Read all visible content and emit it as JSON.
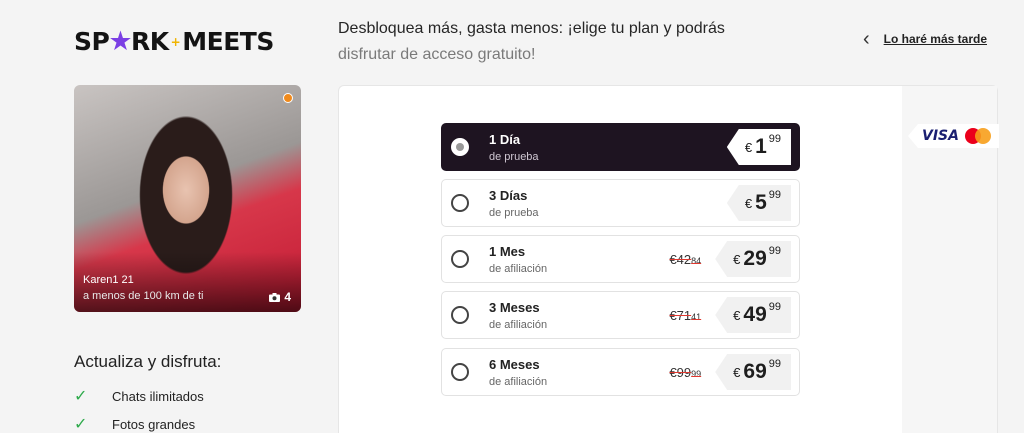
{
  "brand": {
    "logo_left": "SP",
    "logo_star": "★",
    "logo_mid": "RK",
    "logo_plus": "+",
    "logo_right": "MEETS"
  },
  "header": {
    "headline_line1": "Desbloquea más, gasta menos: ¡elige tu plan y podrás",
    "headline_line2": "disfrutar de acceso gratuito!",
    "later_label": "Lo haré más tarde"
  },
  "profile": {
    "name_age": "Karen1 21",
    "distance": "a menos de 100 km de ti",
    "photo_count": "4"
  },
  "upgrade": {
    "title": "Actualiza y disfruta:",
    "features": [
      "Chats ilimitados",
      "Fotos grandes"
    ]
  },
  "payment": {
    "visa_label": "VISA"
  },
  "plans": [
    {
      "title": "1 Día",
      "subtitle": "de prueba",
      "old_whole": "",
      "old_cents": "",
      "currency": "€",
      "price": "1",
      "cents": "99",
      "selected": true
    },
    {
      "title": "3 Días",
      "subtitle": "de prueba",
      "old_whole": "",
      "old_cents": "",
      "currency": "€",
      "price": "5",
      "cents": "99",
      "selected": false
    },
    {
      "title": "1 Mes",
      "subtitle": "de afiliación",
      "old_whole": "€42",
      "old_cents": "84",
      "currency": "€",
      "price": "29",
      "cents": "99",
      "selected": false
    },
    {
      "title": "3 Meses",
      "subtitle": "de afiliación",
      "old_whole": "€71",
      "old_cents": "41",
      "currency": "€",
      "price": "49",
      "cents": "99",
      "selected": false
    },
    {
      "title": "6 Meses",
      "subtitle": "de afiliación",
      "old_whole": "€99",
      "old_cents": "99",
      "currency": "€",
      "price": "69",
      "cents": "99",
      "selected": false
    }
  ],
  "colors": {
    "selected_bg": "#1e1421",
    "check": "#2eaa4b",
    "strike": "#e0382f",
    "online_dot": "#f08a1c"
  }
}
